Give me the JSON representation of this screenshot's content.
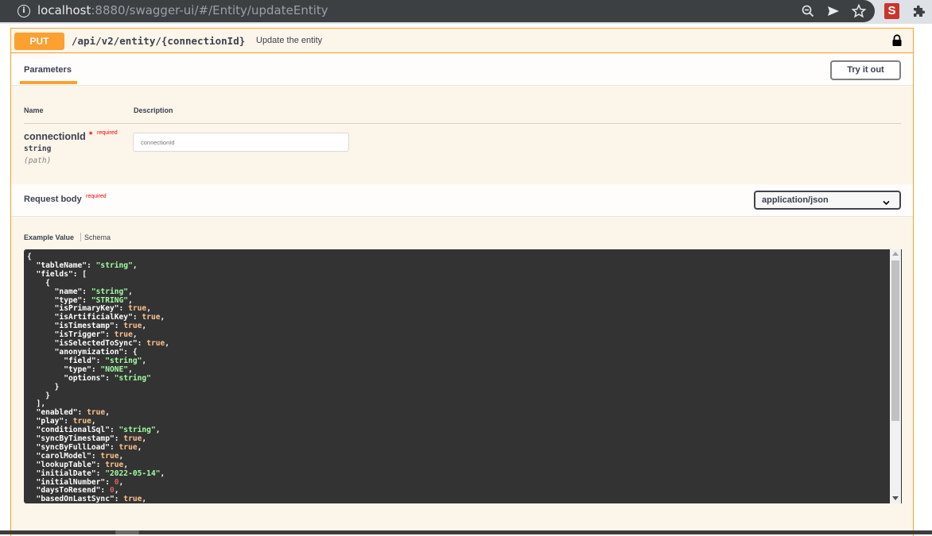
{
  "browser": {
    "url_host": "localhost",
    "url_rest": ":8880/swagger-ui/#/Entity/updateEntity",
    "icons": [
      "info-icon",
      "zoom-icon",
      "send-icon",
      "star-icon",
      "extension-s-icon",
      "puzzle-icon"
    ]
  },
  "operation": {
    "method": "PUT",
    "path": "/api/v2/entity/{connectionId}",
    "summary": "Update the entity",
    "colors": {
      "accent": "#fca130",
      "background": "#fcf5e9"
    }
  },
  "parameters": {
    "tab_label": "Parameters",
    "try_button": "Try it out",
    "col_name": "Name",
    "col_description": "Description",
    "param": {
      "name": "connectionId",
      "required_star": "*",
      "required_label": "required",
      "type": "string",
      "in": "(path)",
      "placeholder": "connectionId"
    }
  },
  "request_body": {
    "title": "Request body",
    "required_label": "required",
    "content_type": "application/json",
    "tab_example": "Example Value",
    "tab_schema": "Schema"
  },
  "example_json": [
    [
      [
        "p",
        "{"
      ]
    ],
    [
      [
        "p",
        "  \"tableName\": "
      ],
      [
        "s",
        "\"string\""
      ],
      [
        "p",
        ","
      ]
    ],
    [
      [
        "p",
        "  \"fields\": ["
      ]
    ],
    [
      [
        "p",
        "    {"
      ]
    ],
    [
      [
        "p",
        "      \"name\": "
      ],
      [
        "s",
        "\"string\""
      ],
      [
        "p",
        ","
      ]
    ],
    [
      [
        "p",
        "      \"type\": "
      ],
      [
        "s",
        "\"STRING\""
      ],
      [
        "p",
        ","
      ]
    ],
    [
      [
        "p",
        "      \"isPrimaryKey\": "
      ],
      [
        "b",
        "true"
      ],
      [
        "p",
        ","
      ]
    ],
    [
      [
        "p",
        "      \"isArtificialKey\": "
      ],
      [
        "b",
        "true"
      ],
      [
        "p",
        ","
      ]
    ],
    [
      [
        "p",
        "      \"isTimestamp\": "
      ],
      [
        "b",
        "true"
      ],
      [
        "p",
        ","
      ]
    ],
    [
      [
        "p",
        "      \"isTrigger\": "
      ],
      [
        "b",
        "true"
      ],
      [
        "p",
        ","
      ]
    ],
    [
      [
        "p",
        "      \"isSelectedToSync\": "
      ],
      [
        "b",
        "true"
      ],
      [
        "p",
        ","
      ]
    ],
    [
      [
        "p",
        "      \"anonymization\": {"
      ]
    ],
    [
      [
        "p",
        "        \"field\": "
      ],
      [
        "s",
        "\"string\""
      ],
      [
        "p",
        ","
      ]
    ],
    [
      [
        "p",
        "        \"type\": "
      ],
      [
        "s",
        "\"NONE\""
      ],
      [
        "p",
        ","
      ]
    ],
    [
      [
        "p",
        "        \"options\": "
      ],
      [
        "s",
        "\"string\""
      ]
    ],
    [
      [
        "p",
        "      }"
      ]
    ],
    [
      [
        "p",
        "    }"
      ]
    ],
    [
      [
        "p",
        "  ],"
      ]
    ],
    [
      [
        "p",
        "  \"enabled\": "
      ],
      [
        "b",
        "true"
      ],
      [
        "p",
        ","
      ]
    ],
    [
      [
        "p",
        "  \"play\": "
      ],
      [
        "b",
        "true"
      ],
      [
        "p",
        ","
      ]
    ],
    [
      [
        "p",
        "  \"conditionalSql\": "
      ],
      [
        "s",
        "\"string\""
      ],
      [
        "p",
        ","
      ]
    ],
    [
      [
        "p",
        "  \"syncByTimestamp\": "
      ],
      [
        "b",
        "true"
      ],
      [
        "p",
        ","
      ]
    ],
    [
      [
        "p",
        "  \"syncByFullLoad\": "
      ],
      [
        "b",
        "true"
      ],
      [
        "p",
        ","
      ]
    ],
    [
      [
        "p",
        "  \"carolModel\": "
      ],
      [
        "b",
        "true"
      ],
      [
        "p",
        ","
      ]
    ],
    [
      [
        "p",
        "  \"lookupTable\": "
      ],
      [
        "b",
        "true"
      ],
      [
        "p",
        ","
      ]
    ],
    [
      [
        "p",
        "  \"initialDate\": "
      ],
      [
        "s",
        "\"2022-05-14\""
      ],
      [
        "p",
        ","
      ]
    ],
    [
      [
        "p",
        "  \"initialNumber\": "
      ],
      [
        "n",
        "0"
      ],
      [
        "p",
        ","
      ]
    ],
    [
      [
        "p",
        "  \"daysToResend\": "
      ],
      [
        "n",
        "0"
      ],
      [
        "p",
        ","
      ]
    ],
    [
      [
        "p",
        "  \"basedOnLastSync\": "
      ],
      [
        "b",
        "true"
      ],
      [
        "p",
        ","
      ]
    ]
  ]
}
